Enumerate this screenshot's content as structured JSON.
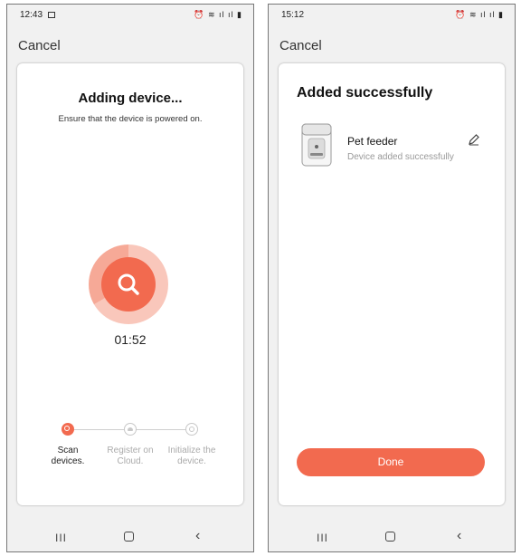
{
  "left": {
    "status": {
      "time": "12:43",
      "icons": "⏰ ≋ ıl ıl ▮"
    },
    "cancel_label": "Cancel",
    "title": "Adding device...",
    "subtitle": "Ensure that the device is powered on.",
    "timer": "01:52",
    "steps": [
      {
        "label": "Scan devices.",
        "state": "active"
      },
      {
        "label": "Register on Cloud.",
        "state": "pending"
      },
      {
        "label": "Initialize the device.",
        "state": "pending"
      }
    ]
  },
  "right": {
    "status": {
      "time": "15:12",
      "icons": "⏰ ≋ ıl ıl ▮"
    },
    "cancel_label": "Cancel",
    "title": "Added successfully",
    "device_name": "Pet feeder",
    "device_status": "Device added successfully",
    "done_label": "Done"
  },
  "nav": {
    "recent": "III",
    "back": "‹"
  },
  "colors": {
    "accent": "#f26a4f",
    "ring_light": "#f9c7bb",
    "ring_mid": "#f6a997"
  }
}
